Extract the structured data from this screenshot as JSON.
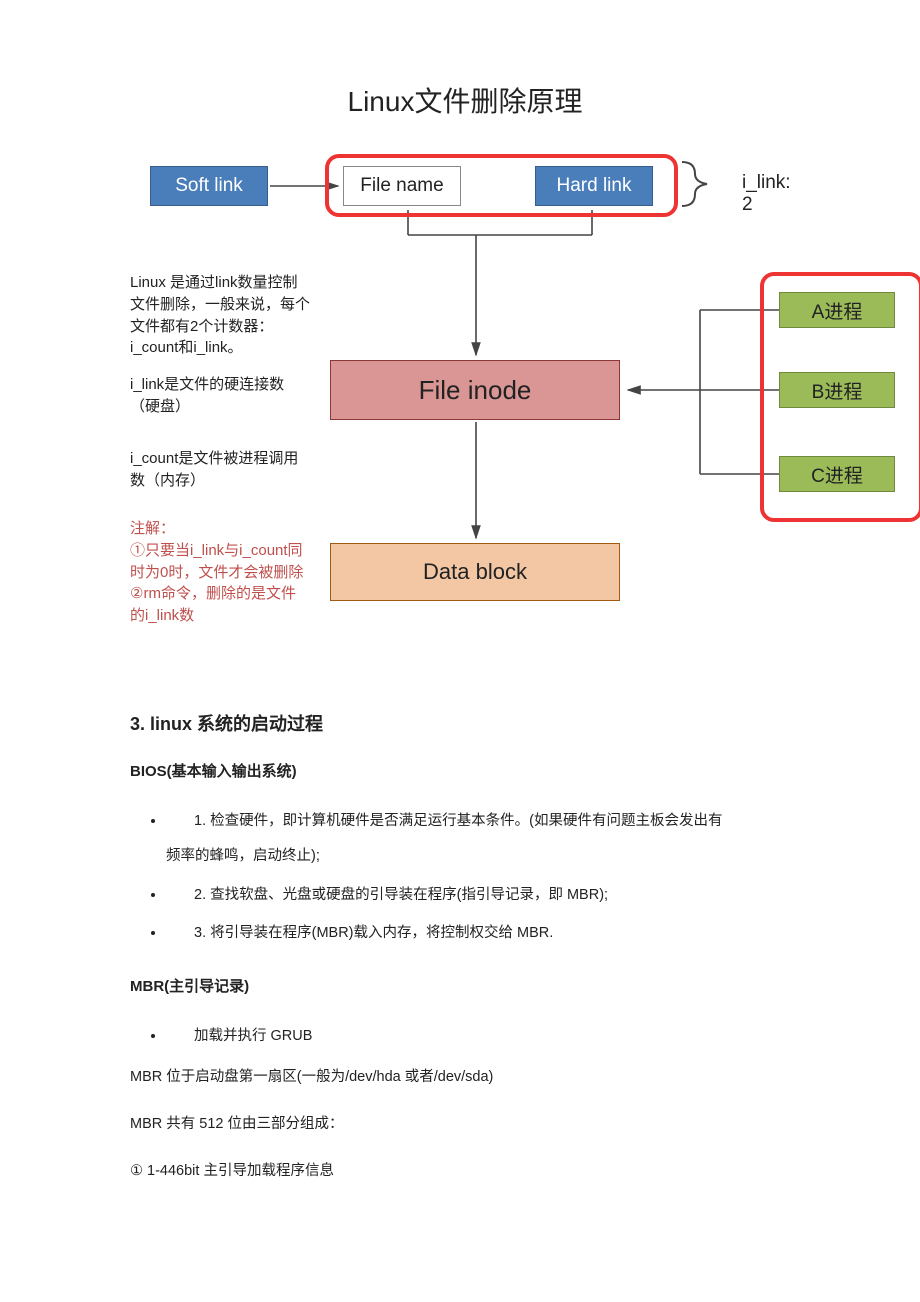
{
  "title": "Linux文件删除原理",
  "diagram": {
    "softlink": "Soft link",
    "filename": "File name",
    "hardlink": "Hard link",
    "ilink_label": "i_link: 2",
    "inode": "File inode",
    "datablock": "Data block",
    "procA": "A进程",
    "procB": "B进程",
    "procC": "C进程",
    "side1": "Linux 是通过link数量控制文件删除，一般来说，每个文件都有2个计数器：i_count和i_link。",
    "side2": "i_link是文件的硬连接数（硬盘）",
    "side3": "i_count是文件被进程调用数（内存）",
    "side4": "注解：\n①只要当i_link与i_count同时为0时，文件才会被删除\n②rm命令，删除的是文件的i_link数"
  },
  "section_heading": "3. linux 系统的启动过程",
  "bios_heading": "BIOS(基本输入输出系统)",
  "bios_items": {
    "i1a": "1.  检查硬件，即计算机硬件是否满足运行基本条件。(如果硬件有问题主板会发出有",
    "i1b": "频率的蜂鸣，启动终止);",
    "i2": "2.  查找软盘、光盘或硬盘的引导装在程序(指引导记录，即 MBR);",
    "i3": "3.  将引导装在程序(MBR)载入内存，将控制权交给 MBR."
  },
  "mbr_heading": "MBR(主引导记录)",
  "mbr_item": "加载并执行 GRUB",
  "mbr_p1": "MBR 位于启动盘第一扇区(一般为/dev/hda 或者/dev/sda)",
  "mbr_p2": "MBR 共有 512 位由三部分组成：",
  "mbr_p3": "①  1-446bit  主引导加载程序信息"
}
